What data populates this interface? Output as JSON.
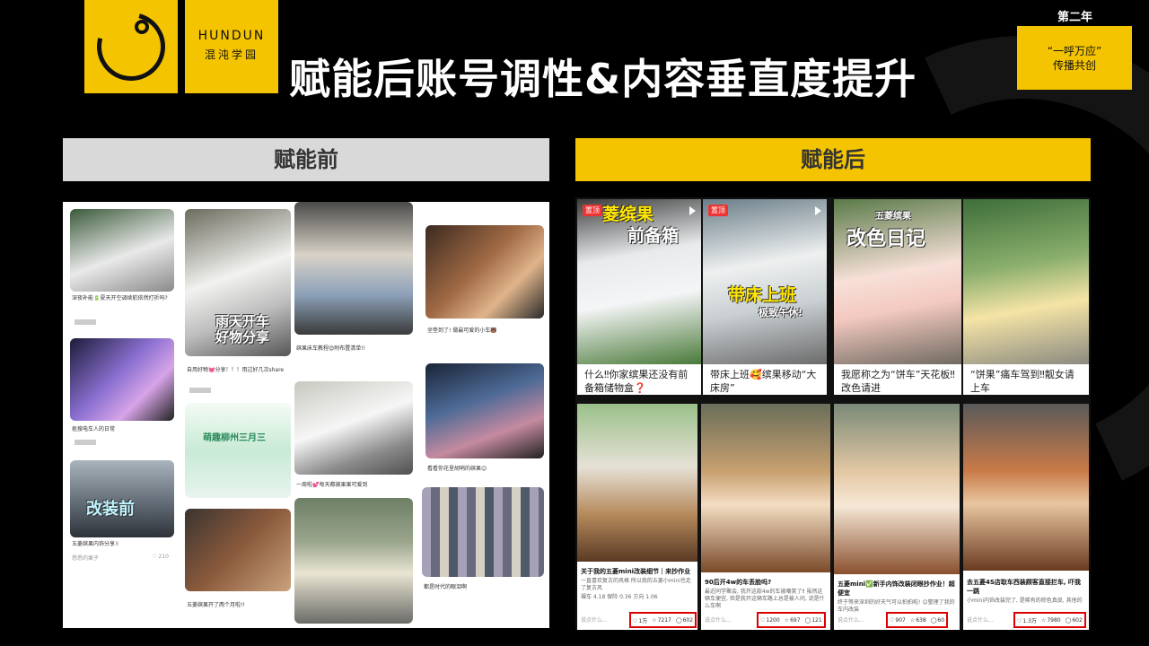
{
  "brand": {
    "en": "HUNDUN",
    "cn": "混沌学园"
  },
  "title": "赋能后账号调性&内容垂直度提升",
  "year_label": "第二年",
  "badge": {
    "line1": "“一呼万应”",
    "line2": "传播共创"
  },
  "sections": {
    "before": "赋能前",
    "after": "赋能后"
  },
  "before_posts": [
    {
      "caption": "深夜补能🔋夏天开空调续航依然打折吗?"
    },
    {
      "overlay": "雨天开车\n好物分享",
      "caption": "自用好物💓分享！！！用过好几次share"
    },
    {
      "caption": "缤果床车教程😍附布置清单!!"
    },
    {
      "caption": "坐垫到了! 做最可爱的小车🐻"
    },
    {
      "caption": "抠搜电车人的日常"
    },
    {
      "overlay": "萌趣柳州三月三",
      "caption": ""
    },
    {
      "caption": "一周啦💕每天都被果果可爱到"
    },
    {
      "caption": "看看你花里胡哨的缤果😊"
    },
    {
      "overlay": "改装前",
      "caption": "五菱缤果内饰分享✌",
      "author": "悉悉的栗子",
      "likes": "210"
    },
    {
      "caption": "五菱缤果开了两个月啦!!"
    },
    {
      "caption": ""
    },
    {
      "caption": "都是时代的眼泪啊"
    }
  ],
  "after_top": [
    {
      "pin": "置顶",
      "overlay1": "菱缤果",
      "overlay2": "前备箱",
      "caption": "什么‼你家缤果还没有前备箱储物盒❓"
    },
    {
      "pin": "置顶",
      "overlay1": "带床上班",
      "overlay2": "极致午休!",
      "caption": "带床上班🥰缤果移动“大床房”"
    },
    {
      "overlay1": "五菱缤果",
      "overlay2": "改色日记",
      "caption": "我愿称之为“饼车”天花板‼改色请进"
    },
    {
      "caption": "“饼果”痛车驾到‼靓女请上车"
    }
  ],
  "after_bottom": [
    {
      "caption": "关于我的五菱mini改装细节｜来抄作业",
      "sub": "一直喜欢复古的风格 所以我的五菱小mini也走了复古风",
      "sub2": "裸车 4.18 保险 0.36 方向 1.06",
      "likes": "1万",
      "stars": "7217",
      "comments": "602"
    },
    {
      "caption": "90后开4w的车丢脸吗?",
      "sub": "最近同学聚会, 我开这款4w的车被嘲笑了‼ 虽然这辆车便宜, 但是我开这辆车路上总是被人问, 说是什么车啊",
      "likes": "1200",
      "stars": "697",
      "comments": "121"
    },
    {
      "caption": "五菱mini✅新手内饰改装闭眼抄作业！超便宜",
      "sub": "终于等来深圳的好天气可以拍拍啦! 😊整理了我的车内改装",
      "likes": "907",
      "stars": "638",
      "comments": "60"
    },
    {
      "caption": "去五菱4S店取车西装顾客直接拦车, 吓我一跳",
      "sub": "小mini内饰改装完了, 是稀有的棕色真皮, 其他的",
      "likes": "1.3万",
      "stars": "7980",
      "comments": "602"
    }
  ],
  "comment_placeholder": "说点什么...",
  "colors": {
    "brand_yellow": "#f5c400",
    "highlight_red": "#dd0000"
  }
}
